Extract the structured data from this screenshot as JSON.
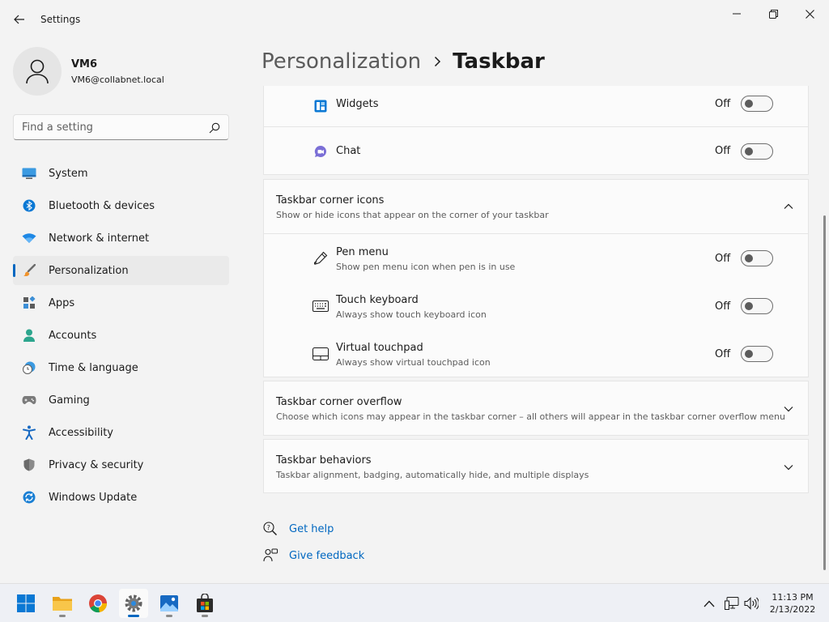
{
  "window": {
    "title": "Settings"
  },
  "profile": {
    "name": "VM6",
    "email": "VM6@collabnet.local"
  },
  "search": {
    "placeholder": "Find a setting"
  },
  "sidebar": {
    "items": [
      {
        "label": "System",
        "icon": "monitor-icon"
      },
      {
        "label": "Bluetooth & devices",
        "icon": "bluetooth-icon"
      },
      {
        "label": "Network & internet",
        "icon": "wifi-icon"
      },
      {
        "label": "Personalization",
        "icon": "paintbrush-icon",
        "active": true
      },
      {
        "label": "Apps",
        "icon": "apps-icon"
      },
      {
        "label": "Accounts",
        "icon": "person-icon"
      },
      {
        "label": "Time & language",
        "icon": "clock-globe-icon"
      },
      {
        "label": "Gaming",
        "icon": "gamepad-icon"
      },
      {
        "label": "Accessibility",
        "icon": "accessibility-icon"
      },
      {
        "label": "Privacy & security",
        "icon": "shield-icon"
      },
      {
        "label": "Windows Update",
        "icon": "update-icon"
      }
    ]
  },
  "breadcrumb": {
    "parent": "Personalization",
    "current": "Taskbar"
  },
  "taskbar_items": [
    {
      "title": "Widgets",
      "state": "Off",
      "on": false,
      "icon": "widgets-icon"
    },
    {
      "title": "Chat",
      "state": "Off",
      "on": false,
      "icon": "chat-icon"
    }
  ],
  "corner_icons": {
    "title": "Taskbar corner icons",
    "subtitle": "Show or hide icons that appear on the corner of your taskbar",
    "expanded": true,
    "items": [
      {
        "title": "Pen menu",
        "subtitle": "Show pen menu icon when pen is in use",
        "state": "Off",
        "on": false,
        "icon": "pen-icon"
      },
      {
        "title": "Touch keyboard",
        "subtitle": "Always show touch keyboard icon",
        "state": "Off",
        "on": false,
        "icon": "keyboard-icon"
      },
      {
        "title": "Virtual touchpad",
        "subtitle": "Always show virtual touchpad icon",
        "state": "Off",
        "on": false,
        "icon": "touchpad-icon"
      }
    ]
  },
  "corner_overflow": {
    "title": "Taskbar corner overflow",
    "subtitle": "Choose which icons may appear in the taskbar corner – all others will appear in the taskbar corner overflow menu",
    "expanded": false
  },
  "behaviors": {
    "title": "Taskbar behaviors",
    "subtitle": "Taskbar alignment, badging, automatically hide, and multiple displays",
    "expanded": false
  },
  "help": {
    "get_help": "Get help",
    "give_feedback": "Give feedback"
  },
  "system_taskbar": {
    "apps": [
      {
        "name": "start",
        "icon": "windows-logo-icon"
      },
      {
        "name": "file-explorer",
        "icon": "folder-icon"
      },
      {
        "name": "chrome",
        "icon": "chrome-icon"
      },
      {
        "name": "settings",
        "icon": "gear-icon",
        "active": true
      },
      {
        "name": "photos",
        "icon": "photos-icon"
      },
      {
        "name": "store",
        "icon": "store-icon"
      }
    ],
    "time": "11:13 PM",
    "date": "2/13/2022"
  },
  "colors": {
    "accent": "#0067c0",
    "background": "#f3f3f3",
    "card": "#fbfbfb"
  }
}
